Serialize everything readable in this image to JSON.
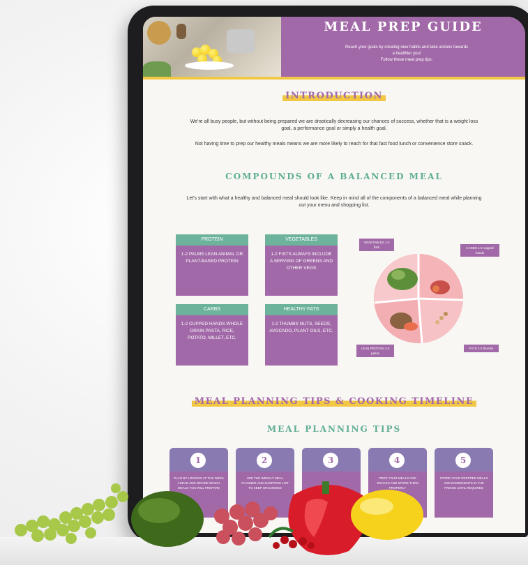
{
  "hero": {
    "title": "MEAL PREP GUIDE",
    "subtitle_line1": "Reach your goals by creating new habits and take actions towards",
    "subtitle_line2": "a healthier you!",
    "subtitle_line3": "Follow these meal prep tips."
  },
  "introduction": {
    "heading": "INTRODUCTION",
    "paragraph1": "We're all busy people, but without being prepared we are drastically decreasing our chances of success, whether that is a weight loss goal, a performance goal or simply a health goal.",
    "paragraph2": "Not having time to prep our healthy meals means we are more likely to reach for that fast food lunch or convenience store snack."
  },
  "balanced": {
    "heading": "COMPOUNDS OF A BALANCED MEAL",
    "paragraph": "Let's start with what a healthy and balanced meal should look like. Keep in mind all of the components of a balanced meal while planning out your menu and shopping list."
  },
  "cards": [
    {
      "title": "PROTEIN",
      "body": "1-2 PALMS LEAN ANIMAL OR PLANT-BASED PROTEIN"
    },
    {
      "title": "VEGETABLES",
      "body": "1-2 FISTS ALWAYS INCLUDE A SERVING OF GREENS AND OTHER VEGS"
    },
    {
      "title": "CARBS",
      "body": "1-2 CUPPED HANDS WHOLE GRAIN PASTA, RICE, POTATO, MILLET, ETC."
    },
    {
      "title": "HEALTHY FATS",
      "body": "1-2 THUMBS NUTS, SEEDS, AVOCADO, PLANT OILS, ETC."
    }
  ],
  "plate_tags": {
    "veg": "VEGETABLES 1-2 fists",
    "carbs": "CARBS 1-2 cupped hands",
    "protein": "LEAN PROTEIN 1-2 palms",
    "fats": "FATS 1-2 thumbs"
  },
  "planning": {
    "heading": "MEAL PLANNING TIPS & COOKING TIMELINE",
    "subheading": "MEAL PLANNING TIPS",
    "tips": [
      {
        "num": "1",
        "text": "PLAN BY LOOKING AT THE WEEK AHEAD AND DECIDE WHICH MEALS YOU WILL PREPARE"
      },
      {
        "num": "2",
        "text": "USE THE WEEKLY MEAL PLANNER AND SHOPPING LIST TO KEEP ORGANISED"
      },
      {
        "num": "3",
        "text": ""
      },
      {
        "num": "4",
        "text": "PREP YOUR MEALS AND SNACKS AND STORE THEM PROPERLY"
      },
      {
        "num": "5",
        "text": "STORE YOUR PREPPED MEALS AND INGREDIENTS IN THE FRIDGE UNTIL REQUIRED"
      }
    ]
  },
  "colors": {
    "purple": "#a269a8",
    "green": "#6db39c",
    "yellow": "#f2c744"
  }
}
